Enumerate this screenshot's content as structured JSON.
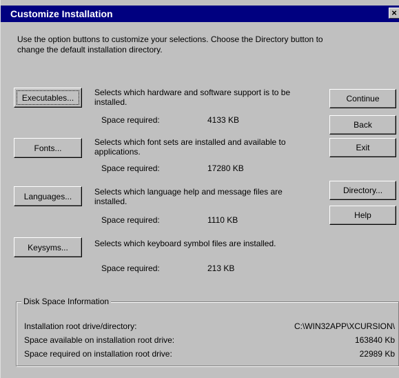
{
  "window": {
    "title": "Customize Installation",
    "close_glyph": "×"
  },
  "intro": {
    "text": "Use the option buttons to customize your selections. Choose the Directory button to change the default installation directory."
  },
  "options": [
    {
      "button_label": "Executables...",
      "description": "Selects which hardware and software support is to be installed.",
      "space_label": "Space required:",
      "space_value": "4133 KB"
    },
    {
      "button_label": "Fonts...",
      "description": "Selects which font sets are installed and available to applications.",
      "space_label": "Space required:",
      "space_value": "17280 KB"
    },
    {
      "button_label": "Languages...",
      "description": "Selects which language help and message files are installed.",
      "space_label": "Space required:",
      "space_value": "1110 KB"
    },
    {
      "button_label": "Keysyms...",
      "description": "Selects which keyboard symbol files are installed.",
      "space_label": "Space required:",
      "space_value": "213 KB"
    }
  ],
  "actions": {
    "continue_label": "Continue",
    "back_label": "Back",
    "exit_label": "Exit",
    "directory_label": "Directory...",
    "help_label": "Help"
  },
  "disk_info": {
    "title": "Disk Space Information",
    "rows": [
      {
        "label": "Installation root drive/directory:",
        "value": "C:\\WIN32APP\\XCURSION\\"
      },
      {
        "label": "Space available on installation root drive:",
        "value": "163840 Kb"
      },
      {
        "label": "Space required on installation root drive:",
        "value": "22989 Kb"
      }
    ]
  }
}
